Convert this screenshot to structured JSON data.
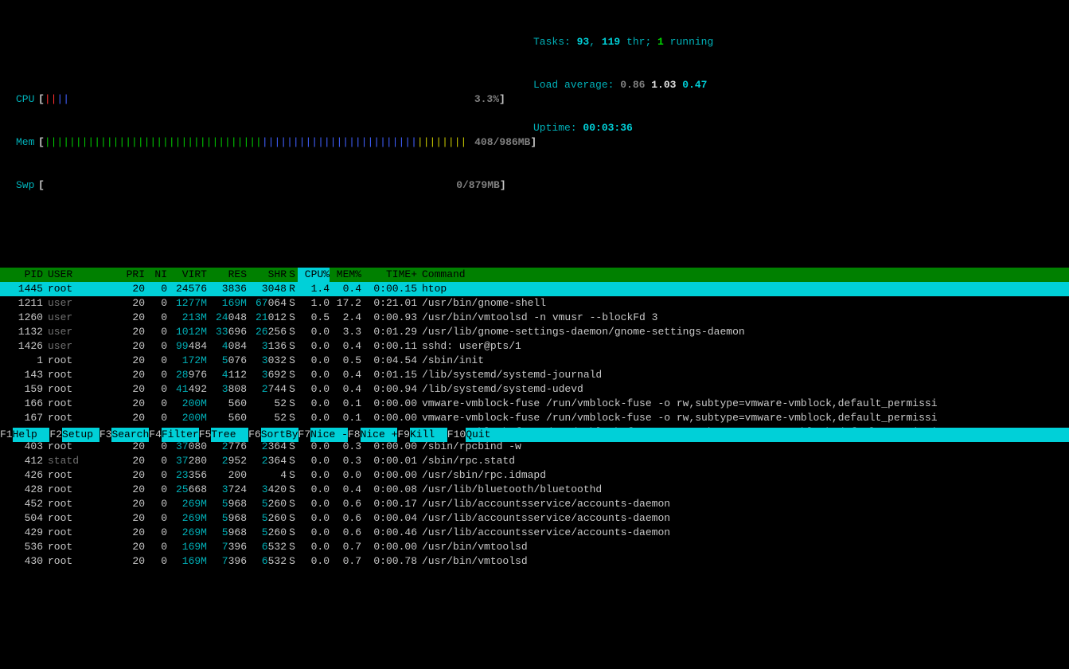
{
  "meters": {
    "cpu": {
      "label": "CPU",
      "bars_red": "||",
      "bars_blue": "||",
      "value": "3.3%"
    },
    "mem": {
      "label": "Mem",
      "bars": "|||||||||||||||||||||||||||||||||||",
      "bars_blue": "|||||||||||||||||||||||||",
      "bars_yellow": "||||||||",
      "value": "408/986MB"
    },
    "swp": {
      "label": "Swp",
      "value": "0/879MB"
    }
  },
  "info": {
    "tasks_lbl": "Tasks: ",
    "tasks": "93",
    "thr": "119",
    "thr_lbl": " thr; ",
    "running": "1",
    "running_lbl": " running",
    "load_lbl": "Load average: ",
    "l1": "0.86",
    "l2": "1.03",
    "l3": "0.47",
    "uptime_lbl": "Uptime: ",
    "uptime": "00:03:36"
  },
  "cols": {
    "pid": "PID",
    "user": "USER",
    "pri": "PRI",
    "ni": "NI",
    "virt": "VIRT",
    "res": "RES",
    "shr": "SHR",
    "s": "S",
    "cpu": "CPU%",
    "mem": "MEM%",
    "time": "TIME+",
    "cmd": "Command"
  },
  "rows": [
    {
      "pid": "1445",
      "user": "root",
      "uc": "root",
      "pri": "20",
      "ni": "0",
      "virt": "24576",
      "virtCyan": false,
      "res": "3836",
      "resPre": "",
      "shr": "3048",
      "shrPre": "",
      "s": "R",
      "sGreen": true,
      "cpu": "1.4",
      "mem": "0.4",
      "time": "0:00.15",
      "cmd": "htop",
      "hl": true
    },
    {
      "pid": "1211",
      "user": "user",
      "uc": "dim",
      "pri": "20",
      "ni": "0",
      "virt": "1277M",
      "virtCyan": true,
      "res": "169M",
      "resPre": "",
      "resCyan": true,
      "shr": "67064",
      "shrPre": "67",
      "s": "S",
      "cpu": "1.0",
      "mem": "17.2",
      "time": "0:21.01",
      "cmd": "/usr/bin/gnome-shell"
    },
    {
      "pid": "1260",
      "user": "user",
      "uc": "dim",
      "pri": "20",
      "ni": "0",
      "virt": "213M",
      "virtCyan": true,
      "res": "24048",
      "resPre": "24",
      "shr": "21012",
      "shrPre": "21",
      "s": "S",
      "cpu": "0.5",
      "mem": "2.4",
      "time": "0:00.93",
      "cmd": "/usr/bin/vmtoolsd -n vmusr --blockFd 3"
    },
    {
      "pid": "1132",
      "user": "user",
      "uc": "dim",
      "pri": "20",
      "ni": "0",
      "virt": "1012M",
      "virtCyan": true,
      "res": "33696",
      "resPre": "33",
      "shr": "26256",
      "shrPre": "26",
      "s": "S",
      "cpu": "0.0",
      "mem": "3.3",
      "time": "0:01.29",
      "cmd": "/usr/lib/gnome-settings-daemon/gnome-settings-daemon"
    },
    {
      "pid": "1426",
      "user": "user",
      "uc": "dim",
      "pri": "20",
      "ni": "0",
      "virt": "99484",
      "virtCyan": false,
      "virtPre": "99",
      "res": "4084",
      "resPre": "4",
      "shr": "3136",
      "shrPre": "3",
      "s": "S",
      "cpu": "0.0",
      "mem": "0.4",
      "time": "0:00.11",
      "cmd": "sshd: user@pts/1"
    },
    {
      "pid": "1",
      "user": "root",
      "uc": "root",
      "pri": "20",
      "ni": "0",
      "virt": "172M",
      "virtCyan": true,
      "res": "5076",
      "resPre": "5",
      "shr": "3032",
      "shrPre": "3",
      "s": "S",
      "cpu": "0.0",
      "mem": "0.5",
      "time": "0:04.54",
      "cmd": "/sbin/init"
    },
    {
      "pid": "143",
      "user": "root",
      "uc": "root",
      "pri": "20",
      "ni": "0",
      "virt": "28976",
      "virtCyan": false,
      "virtPre": "28",
      "res": "4112",
      "resPre": "4",
      "shr": "3692",
      "shrPre": "3",
      "s": "S",
      "cpu": "0.0",
      "mem": "0.4",
      "time": "0:01.15",
      "cmd": "/lib/systemd/systemd-journald"
    },
    {
      "pid": "159",
      "user": "root",
      "uc": "root",
      "pri": "20",
      "ni": "0",
      "virt": "41492",
      "virtCyan": false,
      "virtPre": "41",
      "res": "3808",
      "resPre": "3",
      "shr": "2744",
      "shrPre": "2",
      "s": "S",
      "cpu": "0.0",
      "mem": "0.4",
      "time": "0:00.94",
      "cmd": "/lib/systemd/systemd-udevd"
    },
    {
      "pid": "166",
      "user": "root",
      "uc": "root",
      "pri": "20",
      "ni": "0",
      "virt": "200M",
      "virtCyan": true,
      "res": "560",
      "resPre": "",
      "shr": "52",
      "shrPre": "",
      "s": "S",
      "cpu": "0.0",
      "mem": "0.1",
      "time": "0:00.00",
      "cmd": "vmware-vmblock-fuse /run/vmblock-fuse -o rw,subtype=vmware-vmblock,default_permissi"
    },
    {
      "pid": "167",
      "user": "root",
      "uc": "root",
      "pri": "20",
      "ni": "0",
      "virt": "200M",
      "virtCyan": true,
      "res": "560",
      "resPre": "",
      "shr": "52",
      "shrPre": "",
      "s": "S",
      "cpu": "0.0",
      "mem": "0.1",
      "time": "0:00.00",
      "cmd": "vmware-vmblock-fuse /run/vmblock-fuse -o rw,subtype=vmware-vmblock,default_permissi"
    },
    {
      "pid": "165",
      "user": "root",
      "uc": "root",
      "pri": "20",
      "ni": "0",
      "virt": "200M",
      "virtCyan": true,
      "res": "560",
      "resPre": "",
      "shr": "52",
      "shrPre": "",
      "s": "S",
      "cpu": "0.0",
      "mem": "0.1",
      "time": "0:00.00",
      "cmd": "vmware-vmblock-fuse /run/vmblock-fuse -o rw,subtype=vmware-vmblock,default_permissi"
    },
    {
      "pid": "403",
      "user": "root",
      "uc": "root",
      "pri": "20",
      "ni": "0",
      "virt": "37080",
      "virtCyan": false,
      "virtPre": "37",
      "res": "2776",
      "resPre": "2",
      "shr": "2364",
      "shrPre": "2",
      "s": "S",
      "cpu": "0.0",
      "mem": "0.3",
      "time": "0:00.00",
      "cmd": "/sbin/rpcbind -w"
    },
    {
      "pid": "412",
      "user": "statd",
      "uc": "dim",
      "pri": "20",
      "ni": "0",
      "virt": "37280",
      "virtCyan": false,
      "virtPre": "37",
      "res": "2952",
      "resPre": "2",
      "shr": "2364",
      "shrPre": "2",
      "s": "S",
      "cpu": "0.0",
      "mem": "0.3",
      "time": "0:00.01",
      "cmd": "/sbin/rpc.statd"
    },
    {
      "pid": "426",
      "user": "root",
      "uc": "root",
      "pri": "20",
      "ni": "0",
      "virt": "23356",
      "virtCyan": false,
      "virtPre": "23",
      "res": "200",
      "resPre": "",
      "shr": "4",
      "shrPre": "",
      "s": "S",
      "cpu": "0.0",
      "mem": "0.0",
      "time": "0:00.00",
      "cmd": "/usr/sbin/rpc.idmapd"
    },
    {
      "pid": "428",
      "user": "root",
      "uc": "root",
      "pri": "20",
      "ni": "0",
      "virt": "25668",
      "virtCyan": false,
      "virtPre": "25",
      "res": "3724",
      "resPre": "3",
      "shr": "3420",
      "shrPre": "3",
      "s": "S",
      "cpu": "0.0",
      "mem": "0.4",
      "time": "0:00.08",
      "cmd": "/usr/lib/bluetooth/bluetoothd"
    },
    {
      "pid": "452",
      "user": "root",
      "uc": "root",
      "pri": "20",
      "ni": "0",
      "virt": "269M",
      "virtCyan": true,
      "res": "5968",
      "resPre": "5",
      "shr": "5260",
      "shrPre": "5",
      "s": "S",
      "cpu": "0.0",
      "mem": "0.6",
      "time": "0:00.17",
      "cmd": "/usr/lib/accountsservice/accounts-daemon"
    },
    {
      "pid": "504",
      "user": "root",
      "uc": "root",
      "pri": "20",
      "ni": "0",
      "virt": "269M",
      "virtCyan": true,
      "res": "5968",
      "resPre": "5",
      "shr": "5260",
      "shrPre": "5",
      "s": "S",
      "cpu": "0.0",
      "mem": "0.6",
      "time": "0:00.04",
      "cmd": "/usr/lib/accountsservice/accounts-daemon"
    },
    {
      "pid": "429",
      "user": "root",
      "uc": "root",
      "pri": "20",
      "ni": "0",
      "virt": "269M",
      "virtCyan": true,
      "res": "5968",
      "resPre": "5",
      "shr": "5260",
      "shrPre": "5",
      "s": "S",
      "cpu": "0.0",
      "mem": "0.6",
      "time": "0:00.46",
      "cmd": "/usr/lib/accountsservice/accounts-daemon"
    },
    {
      "pid": "536",
      "user": "root",
      "uc": "root",
      "pri": "20",
      "ni": "0",
      "virt": "169M",
      "virtCyan": true,
      "res": "7396",
      "resPre": "7",
      "shr": "6532",
      "shrPre": "6",
      "s": "S",
      "cpu": "0.0",
      "mem": "0.7",
      "time": "0:00.00",
      "cmd": "/usr/bin/vmtoolsd"
    },
    {
      "pid": "430",
      "user": "root",
      "uc": "root",
      "pri": "20",
      "ni": "0",
      "virt": "169M",
      "virtCyan": true,
      "res": "7396",
      "resPre": "7",
      "shr": "6532",
      "shrPre": "6",
      "s": "S",
      "cpu": "0.0",
      "mem": "0.7",
      "time": "0:00.78",
      "cmd": "/usr/bin/vmtoolsd"
    }
  ],
  "footer": [
    {
      "key": "F1",
      "name": "Help  "
    },
    {
      "key": "F2",
      "name": "Setup "
    },
    {
      "key": "F3",
      "name": "Search"
    },
    {
      "key": "F4",
      "name": "Filter"
    },
    {
      "key": "F5",
      "name": "Tree  "
    },
    {
      "key": "F6",
      "name": "SortBy"
    },
    {
      "key": "F7",
      "name": "Nice -"
    },
    {
      "key": "F8",
      "name": "Nice +"
    },
    {
      "key": "F9",
      "name": "Kill  "
    },
    {
      "key": "F10",
      "name": "Quit  "
    }
  ]
}
